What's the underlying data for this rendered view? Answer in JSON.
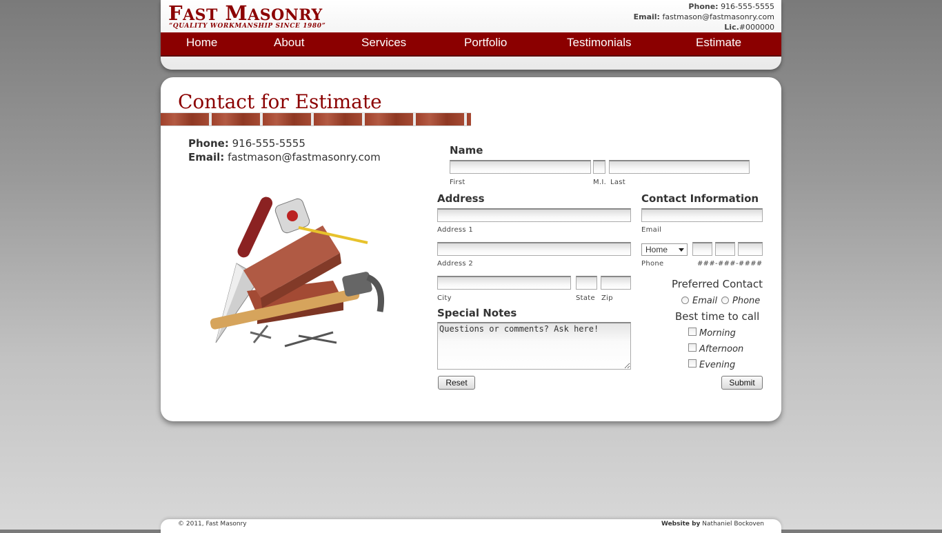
{
  "brand": {
    "name_first_letter": "F",
    "name_first_rest": "AST",
    "name_second_letter": "M",
    "name_second_rest": "ASONRY",
    "tagline": "“Quality Workmanship since 1980”"
  },
  "header_contact": {
    "phone_label": "Phone:",
    "phone": "916-555-5555",
    "email_label": "Email:",
    "email": "fastmason@fastmasonry.com",
    "lic_label": "Lic.",
    "lic": "#000000"
  },
  "nav": [
    "Home",
    "About",
    "Services",
    "Portfolio",
    "Testimonials",
    "Estimate"
  ],
  "page": {
    "title": "Contact for Estimate",
    "phone_label": "Phone:",
    "phone": "916-555-5555",
    "email_label": "Email:",
    "email": "fastmason@fastmasonry.com"
  },
  "form": {
    "name_heading": "Name",
    "first_label": "First",
    "mi_label": "M.I.",
    "last_label": "Last",
    "address_heading": "Address",
    "address1_label": "Address 1",
    "address2_label": "Address 2",
    "city_label": "City",
    "state_label": "State",
    "zip_label": "Zip",
    "contact_heading": "Contact Information",
    "email_label": "Email",
    "phone_type_selected": "Home",
    "phone_label": "Phone",
    "phone_format": "###-###-####",
    "preferred_heading": "Preferred Contact",
    "preferred_options": [
      "Email",
      "Phone"
    ],
    "best_time_heading": "Best time to call",
    "time_options": [
      "Morning",
      "Afternoon",
      "Evening"
    ],
    "notes_heading": "Special Notes",
    "notes_placeholder": "Questions or comments? Ask here!",
    "reset_label": "Reset",
    "submit_label": "Submit"
  },
  "footer": {
    "copyright": "© 2011, Fast Masonry",
    "credit_label": "Website by",
    "credit_name": "Nathaniel Bockoven"
  }
}
